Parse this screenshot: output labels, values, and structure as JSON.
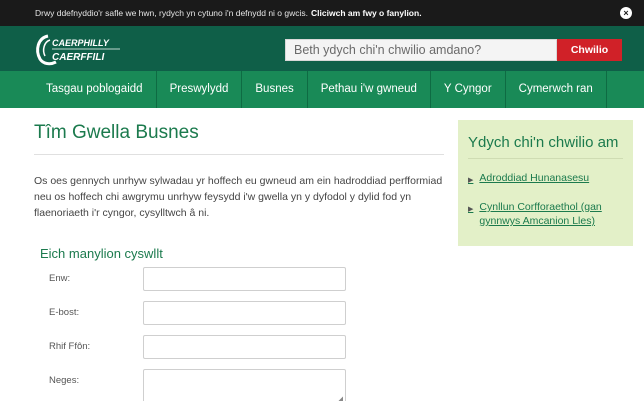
{
  "cookie_bar": {
    "text": "Drwy ddefnyddio'r safle we hwn, rydych yn cytuno i'n defnydd ni o gwcis.",
    "link": "Cliciwch am fwy o fanylion.",
    "close_symbol": "×"
  },
  "header": {
    "logo_top": "CAERPHILLY",
    "logo_bottom": "CAERFFILI",
    "search_placeholder": "Beth ydych chi'n chwilio amdano?",
    "search_button": "Chwilio"
  },
  "nav": {
    "items": [
      "Tasgau poblogaidd",
      "Preswylydd",
      "Busnes",
      "Pethau i'w gwneud",
      "Y Cyngor",
      "Cymerwch ran"
    ]
  },
  "main": {
    "title": "Tîm Gwella Busnes",
    "intro": "Os oes gennych unrhyw sylwadau yr hoffech eu gwneud am ein hadroddiad perfformiad neu os hoffech chi awgrymu unrhyw feysydd i'w gwella yn y dyfodol y dylid fod yn flaenoriaeth i'r cyngor, cysylltwch â ni.",
    "form_heading": "Eich manylion cyswllt",
    "fields": {
      "name_label": "Enw:",
      "email_label": "E-bost:",
      "phone_label": "Rhif Ffôn:",
      "message_label": "Neges:"
    }
  },
  "sidebar": {
    "title": "Ydych chi'n chwilio am",
    "links": [
      "Adroddiad Hunanasesu",
      "Cynllun Corfforaethol (gan gynnwys Amcanion Lles)"
    ]
  },
  "colors": {
    "header_green": "#0f5f48",
    "nav_green": "#198a57",
    "accent_green": "#1b7a4d",
    "search_red": "#d02128",
    "sidebar_bg": "#e3f0c8"
  }
}
